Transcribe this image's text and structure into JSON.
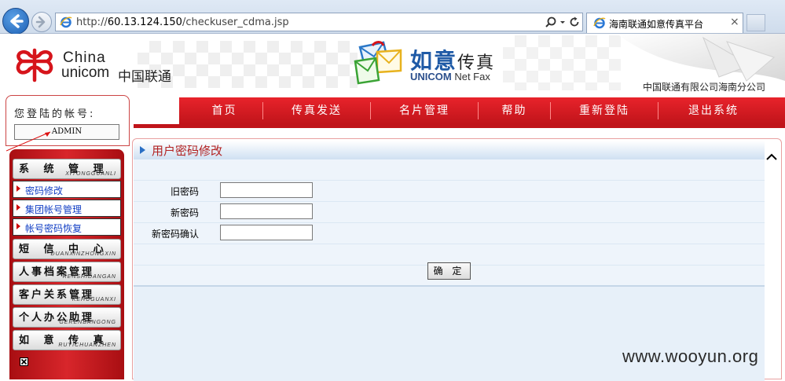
{
  "browser": {
    "url_prefix": "http://",
    "url_host": "60.13.124.150",
    "url_path": "/checkuser_cdma.jsp",
    "tab_title": "海南联通如意传真平台",
    "tab_close": "×"
  },
  "header": {
    "logo_line1": "China",
    "logo_line2": "unicom",
    "logo_cn": "中国联通",
    "product_name": "如意",
    "product_suffix": "传真",
    "product_en": "UNICOM",
    "product_en2": " Net Fax",
    "company": "中国联通有限公司海南分公司"
  },
  "nav": {
    "items": [
      "首页",
      "传真发送",
      "名片管理",
      "帮助",
      "重新登陆",
      "退出系统"
    ]
  },
  "login": {
    "label": "您登陆的帐号:",
    "account": "ADMIN"
  },
  "sidebar": {
    "groups": [
      {
        "title": "系 统 管 理",
        "pinyin": "XITONGGUANLI"
      },
      {
        "title": "短 信 中 心",
        "pinyin": "DUANXINZHONGXIN"
      },
      {
        "title": "人事档案管理",
        "pinyin": "RENSHIDANGAN"
      },
      {
        "title": "客户关系管理",
        "pinyin": "KEHUGUANXI"
      },
      {
        "title": "个人办公助理",
        "pinyin": "GERENBANGONG"
      },
      {
        "title": "如 意 传 真",
        "pinyin": "RUYICHUANZHEN"
      }
    ],
    "sub_items": [
      "密码修改",
      "集团帐号管理",
      "帐号密码恢复"
    ]
  },
  "panel": {
    "title": "用户密码修改",
    "fields": [
      {
        "label": "旧密码",
        "value": ""
      },
      {
        "label": "新密码",
        "value": ""
      },
      {
        "label": "新密码确认",
        "value": ""
      }
    ],
    "confirm_label": "确 定"
  },
  "watermark": "www.wooyun.org",
  "colors": {
    "nav_red": "#d8262b",
    "link_blue": "#113ec4",
    "title_red": "#b22222",
    "panel_blue": "#eef4fb"
  }
}
